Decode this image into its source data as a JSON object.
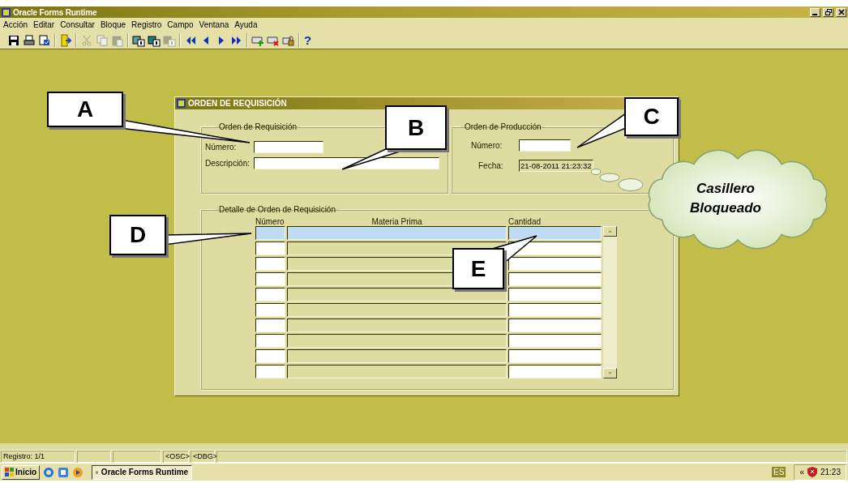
{
  "window": {
    "title": "Oracle Forms Runtime"
  },
  "menu": [
    "Acción",
    "Editar",
    "Consultar",
    "Bloque",
    "Registro",
    "Campo",
    "Ventana",
    "Ayuda"
  ],
  "toolbar": {
    "groups": [
      {
        "items": [
          {
            "kind": "save",
            "disabled": false
          },
          {
            "kind": "print",
            "disabled": false
          },
          {
            "kind": "preview",
            "disabled": false
          }
        ]
      },
      {
        "items": [
          {
            "kind": "exit",
            "disabled": false
          }
        ]
      },
      {
        "items": [
          {
            "kind": "cut",
            "disabled": true
          },
          {
            "kind": "copy",
            "disabled": true
          },
          {
            "kind": "paste",
            "disabled": true
          }
        ]
      },
      {
        "items": [
          {
            "kind": "enter_query",
            "disabled": false
          },
          {
            "kind": "execute_query",
            "disabled": false
          },
          {
            "kind": "cancel_query",
            "disabled": true
          }
        ]
      },
      {
        "items": [
          {
            "kind": "first",
            "disabled": false
          },
          {
            "kind": "prev",
            "disabled": false
          },
          {
            "kind": "next",
            "disabled": false
          },
          {
            "kind": "last",
            "disabled": false
          }
        ]
      },
      {
        "items": [
          {
            "kind": "insert",
            "disabled": false
          },
          {
            "kind": "delete",
            "disabled": false
          },
          {
            "kind": "lock",
            "disabled": false
          }
        ]
      }
    ],
    "help_label": "?"
  },
  "form": {
    "title": "ORDEN DE REQUISICIÓN",
    "requisition_group": {
      "title": "Orden de Requisición",
      "fields": [
        {
          "label": "Número:",
          "disabled": false
        },
        {
          "label": "Descripción:",
          "disabled": false
        }
      ]
    },
    "production_group": {
      "title": "Orden de Producción",
      "fields": [
        {
          "label": "Número:",
          "disabled": false
        },
        {
          "label": "Fecha:",
          "value": "21-08-2011 21:23:32",
          "disabled": true
        }
      ]
    },
    "detail_group": {
      "title": "Detalle de Orden de Requisición",
      "columns": [
        "Número",
        "Materia Prima",
        "Cantidad"
      ],
      "rows": [
        {
          "selected": true
        },
        {
          "selected": false
        },
        {
          "selected": false
        },
        {
          "selected": false
        },
        {
          "selected": false
        },
        {
          "selected": false
        },
        {
          "selected": false
        },
        {
          "selected": false
        },
        {
          "selected": false
        },
        {
          "selected": false
        }
      ]
    }
  },
  "annotations": {
    "callouts": [
      {
        "label": "A"
      },
      {
        "label": "B"
      },
      {
        "label": "C"
      },
      {
        "label": "D"
      },
      {
        "label": "E"
      }
    ],
    "cloud": {
      "text": "Casillero Bloqueado"
    }
  },
  "status_bar": {
    "record": "Registro: 1/1",
    "indicators": [
      "<OSC>",
      "<DBG>"
    ]
  },
  "taskbar": {
    "start": "Inicio",
    "tasks": [
      {
        "label": "Oracle Forms Runtime",
        "selected": true
      }
    ],
    "language": "ES",
    "tray_expand": "«",
    "clock": "21:23"
  }
}
